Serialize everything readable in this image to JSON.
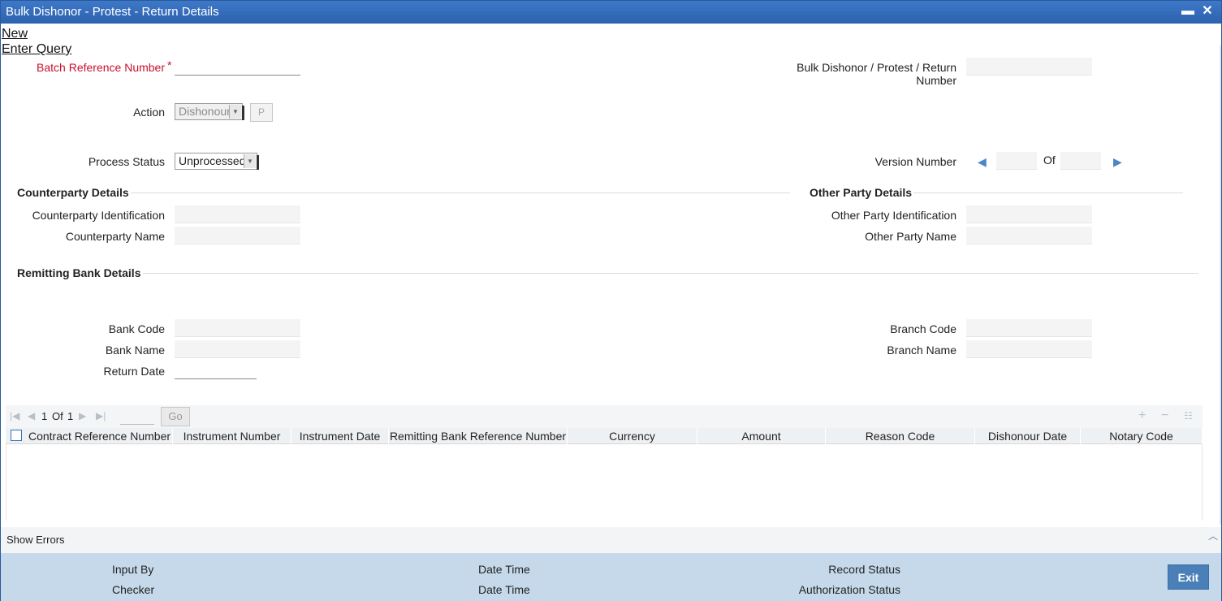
{
  "window": {
    "title": "Bulk Dishonor - Protest - Return Details",
    "minimize": "▬",
    "close": "✕"
  },
  "menu": {
    "new": "New",
    "enter_query": "Enter Query"
  },
  "form": {
    "batch_reference_label": "Batch Reference Number",
    "required_mark": "*",
    "bulk_number_label_1": "Bulk Dishonor / Protest / Return",
    "bulk_number_label_2": "Number",
    "action_label": "Action",
    "action_value": "Dishonour",
    "p_button": "P",
    "process_status_label": "Process Status",
    "process_status_value": "Unprocessed",
    "version_label": "Version Number",
    "version_of": "Of"
  },
  "counterparty": {
    "heading": "Counterparty Details",
    "id_label": "Counterparty Identification",
    "name_label": "Counterparty Name"
  },
  "other_party": {
    "heading": "Other Party Details",
    "id_label": "Other Party Identification",
    "name_label": "Other Party Name"
  },
  "remitting_bank": {
    "heading": "Remitting Bank Details",
    "bank_code_label": "Bank Code",
    "bank_name_label": "Bank Name",
    "return_date_label": "Return Date",
    "branch_code_label": "Branch Code",
    "branch_name_label": "Branch Name"
  },
  "grid": {
    "page_current": "1",
    "page_of": "Of",
    "page_total": "1",
    "go": "Go",
    "columns": [
      "Contract Reference Number",
      "Instrument Number",
      "Instrument Date",
      "Remitting Bank Reference Number",
      "Currency",
      "Amount",
      "Reason Code",
      "Dishonour Date",
      "Notary Code"
    ]
  },
  "errors": {
    "label": "Show Errors"
  },
  "footer": {
    "input_by": "Input By",
    "checker": "Checker",
    "date_time_1": "Date Time",
    "date_time_2": "Date Time",
    "record_status": "Record Status",
    "authorization_status": "Authorization Status",
    "exit": "Exit"
  }
}
